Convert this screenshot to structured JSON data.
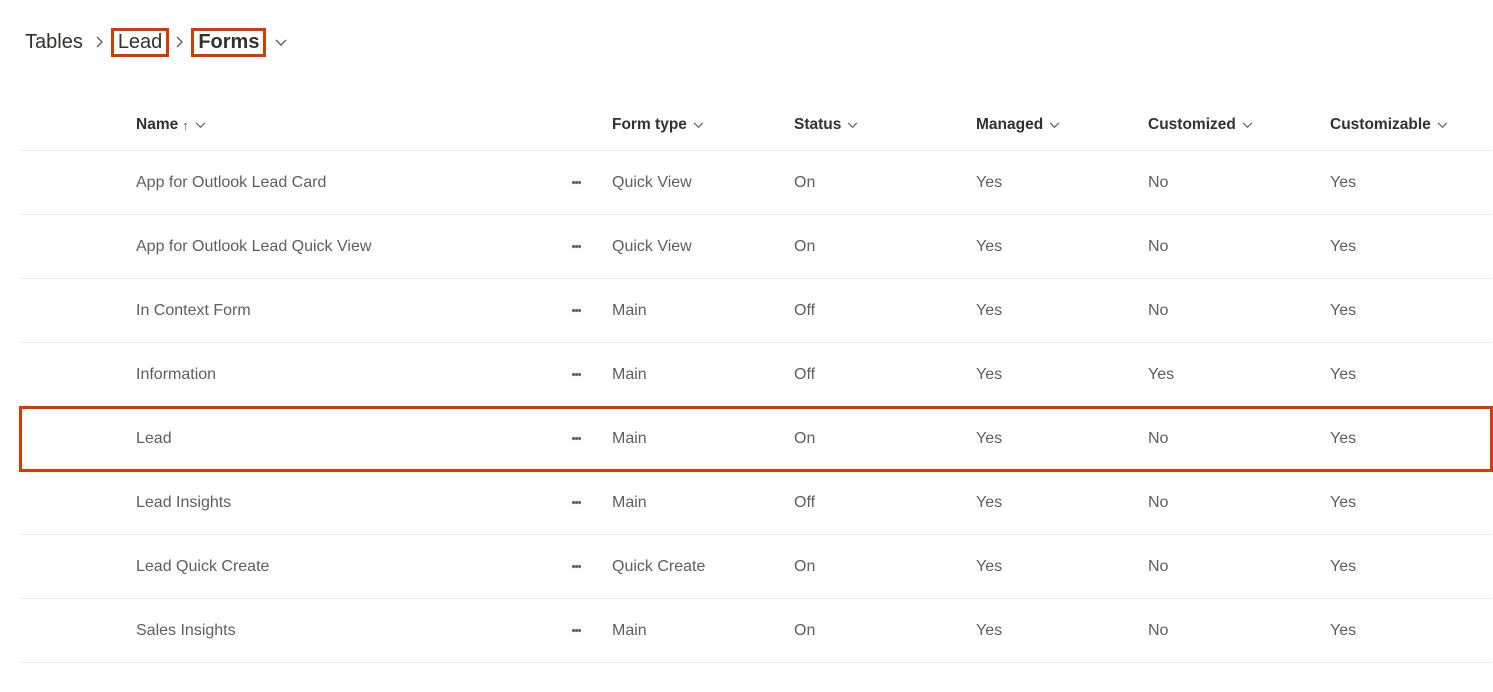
{
  "breadcrumb": {
    "root": "Tables",
    "entity": "Lead",
    "current": "Forms"
  },
  "columns": {
    "name": "Name",
    "form_type": "Form type",
    "status": "Status",
    "managed": "Managed",
    "customized": "Customized",
    "customizable": "Customizable"
  },
  "sort_indicator": "↑",
  "rows": [
    {
      "name": "App for Outlook Lead Card",
      "form_type": "Quick View",
      "status": "On",
      "managed": "Yes",
      "customized": "No",
      "customizable": "Yes",
      "highlighted": false
    },
    {
      "name": "App for Outlook Lead Quick View",
      "form_type": "Quick View",
      "status": "On",
      "managed": "Yes",
      "customized": "No",
      "customizable": "Yes",
      "highlighted": false
    },
    {
      "name": "In Context Form",
      "form_type": "Main",
      "status": "Off",
      "managed": "Yes",
      "customized": "No",
      "customizable": "Yes",
      "highlighted": false
    },
    {
      "name": "Information",
      "form_type": "Main",
      "status": "Off",
      "managed": "Yes",
      "customized": "Yes",
      "customizable": "Yes",
      "highlighted": false
    },
    {
      "name": "Lead",
      "form_type": "Main",
      "status": "On",
      "managed": "Yes",
      "customized": "No",
      "customizable": "Yes",
      "highlighted": true
    },
    {
      "name": "Lead Insights",
      "form_type": "Main",
      "status": "Off",
      "managed": "Yes",
      "customized": "No",
      "customizable": "Yes",
      "highlighted": false
    },
    {
      "name": "Lead Quick Create",
      "form_type": "Quick Create",
      "status": "On",
      "managed": "Yes",
      "customized": "No",
      "customizable": "Yes",
      "highlighted": false
    },
    {
      "name": "Sales Insights",
      "form_type": "Main",
      "status": "On",
      "managed": "Yes",
      "customized": "No",
      "customizable": "Yes",
      "highlighted": false
    }
  ]
}
